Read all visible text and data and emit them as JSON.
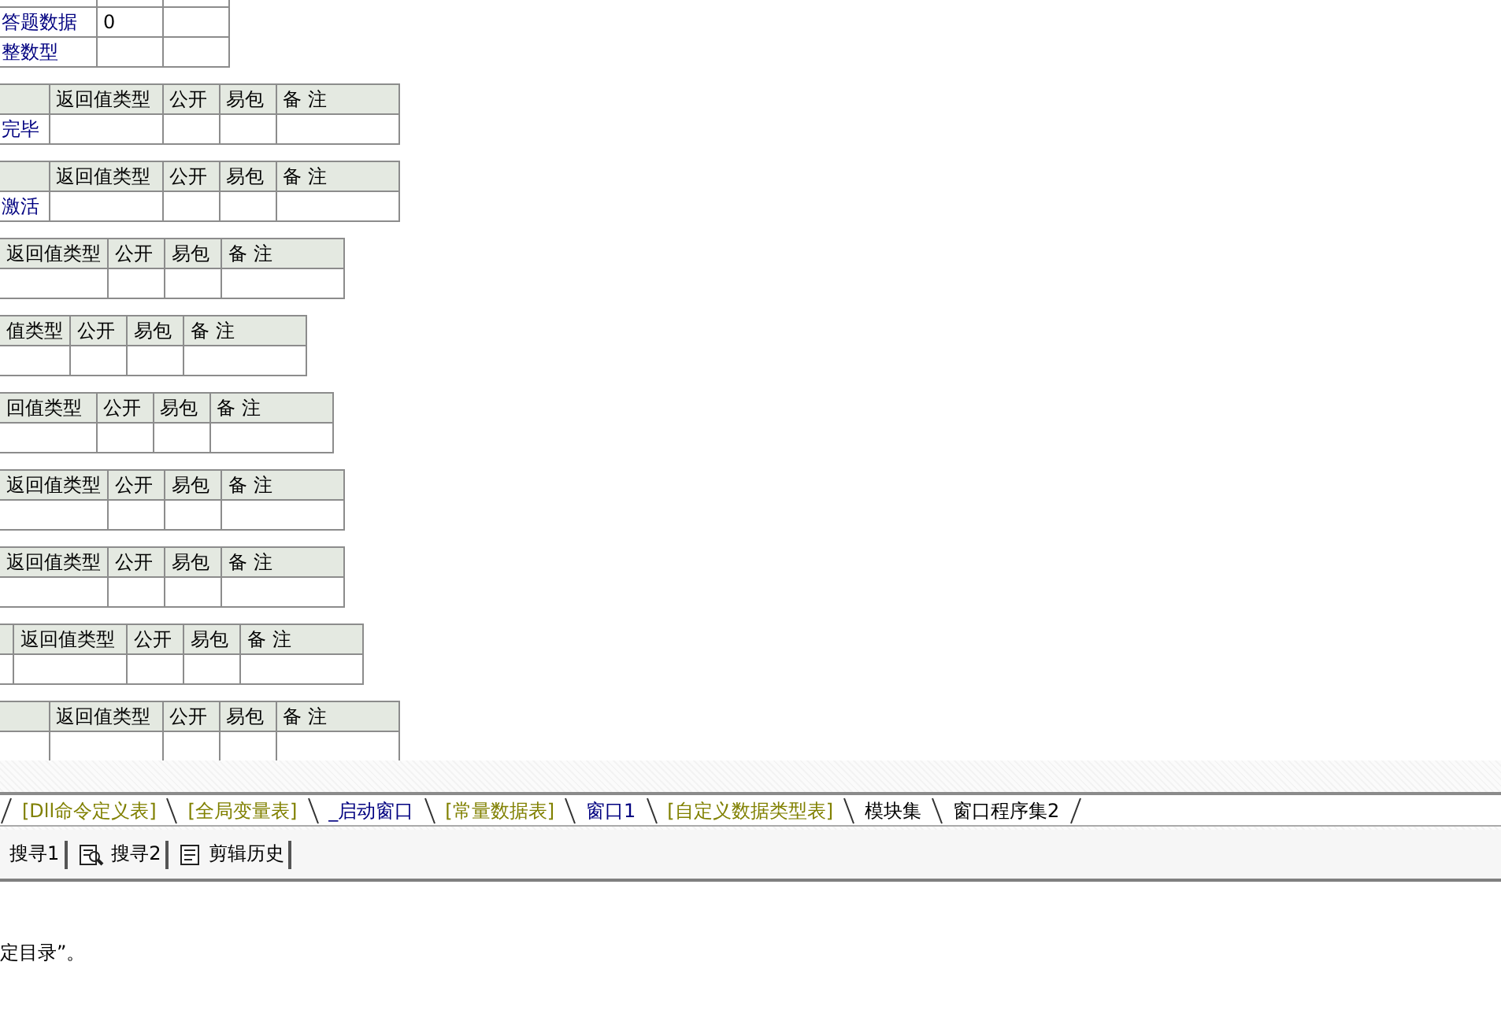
{
  "top_table": {
    "rows": [
      {
        "column_1": "答题数据",
        "column_2": "0"
      },
      {
        "column_1": "整数型"
      }
    ]
  },
  "subroutine_tables": [
    {
      "columns": [
        "返回值类型",
        "公开",
        "易包",
        "备 注"
      ],
      "name": "完毕"
    },
    {
      "columns": [
        "返回值类型",
        "公开",
        "易包",
        "备 注"
      ],
      "name": "激活"
    },
    {
      "columns": [
        "返回值类型",
        "公开",
        "易包",
        "备 注"
      ]
    },
    {
      "columns": [
        "值类型",
        "公开",
        "易包",
        "备 注"
      ]
    },
    {
      "columns": [
        "回值类型",
        "公开",
        "易包",
        "备 注"
      ]
    },
    {
      "columns": [
        "返回值类型",
        "公开",
        "易包",
        "备 注"
      ]
    },
    {
      "columns": [
        "返回值类型",
        "公开",
        "易包",
        "备 注"
      ]
    },
    {
      "columns": [
        "返回值类型",
        "公开",
        "易包",
        "备 注"
      ]
    },
    {
      "columns": [
        "返回值类型",
        "公开",
        "易包",
        "备 注"
      ]
    }
  ],
  "editor_tabs": [
    {
      "label": "[Dll命令定义表]",
      "color": "#808000"
    },
    {
      "label": "[全局变量表]",
      "color": "#808000"
    },
    {
      "label": "_启动窗口",
      "color": "#000080"
    },
    {
      "label": "[常量数据表]",
      "color": "#808000"
    },
    {
      "label": "窗口1",
      "color": "#000080"
    },
    {
      "label": "[自定义数据类型表]",
      "color": "#808000"
    },
    {
      "label": "模块集",
      "color": "#000000"
    },
    {
      "label": "窗口程序集2",
      "color": "#000000"
    }
  ],
  "output_tabs": [
    {
      "label": "搜寻1"
    },
    {
      "label": "搜寻2",
      "kind": "search"
    },
    {
      "label": "剪辑历史",
      "kind": "clipboard"
    }
  ],
  "output_text": "定目录”。"
}
